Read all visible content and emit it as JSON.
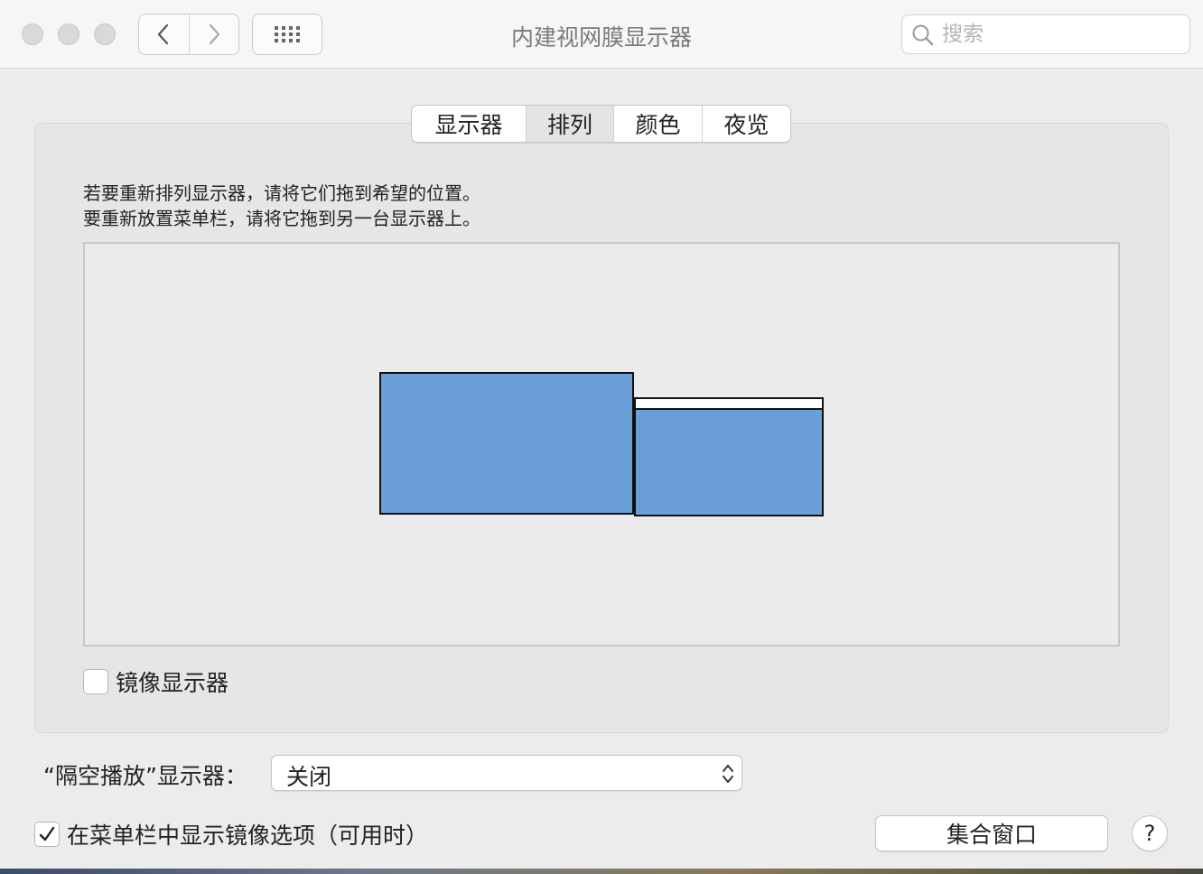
{
  "window": {
    "title": "内建视网膜显示器"
  },
  "search": {
    "placeholder": "搜索"
  },
  "tabs": [
    {
      "label": "显示器"
    },
    {
      "label": "排列"
    },
    {
      "label": "颜色"
    },
    {
      "label": "夜览"
    }
  ],
  "selected_tab": "排列",
  "instructions": {
    "line1": "若要重新排列显示器，请将它们拖到希望的位置。",
    "line2": "要重新放置菜单栏，请将它拖到另一台显示器上。"
  },
  "arrangement": {
    "display_color": "#6a9fd7"
  },
  "mirror": {
    "label": "镜像显示器",
    "checked": false
  },
  "airplay": {
    "label": "“隔空播放”显示器：",
    "selected_value": "关闭"
  },
  "menu_option": {
    "label": "在菜单栏中显示镜像选项（可用时）",
    "checked": true
  },
  "gather_button": {
    "label": "集合窗口"
  },
  "help_button": {
    "label": "?"
  }
}
